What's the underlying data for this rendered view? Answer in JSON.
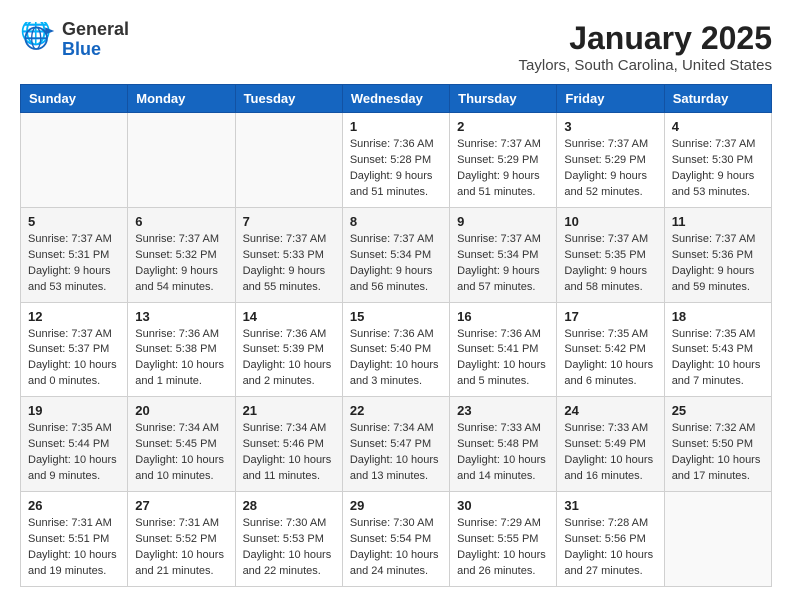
{
  "header": {
    "logo_general": "General",
    "logo_blue": "Blue",
    "month": "January 2025",
    "location": "Taylors, South Carolina, United States"
  },
  "weekdays": [
    "Sunday",
    "Monday",
    "Tuesday",
    "Wednesday",
    "Thursday",
    "Friday",
    "Saturday"
  ],
  "weeks": [
    [
      {
        "day": "",
        "info": ""
      },
      {
        "day": "",
        "info": ""
      },
      {
        "day": "",
        "info": ""
      },
      {
        "day": "1",
        "info": "Sunrise: 7:36 AM\nSunset: 5:28 PM\nDaylight: 9 hours\nand 51 minutes."
      },
      {
        "day": "2",
        "info": "Sunrise: 7:37 AM\nSunset: 5:29 PM\nDaylight: 9 hours\nand 51 minutes."
      },
      {
        "day": "3",
        "info": "Sunrise: 7:37 AM\nSunset: 5:29 PM\nDaylight: 9 hours\nand 52 minutes."
      },
      {
        "day": "4",
        "info": "Sunrise: 7:37 AM\nSunset: 5:30 PM\nDaylight: 9 hours\nand 53 minutes."
      }
    ],
    [
      {
        "day": "5",
        "info": "Sunrise: 7:37 AM\nSunset: 5:31 PM\nDaylight: 9 hours\nand 53 minutes."
      },
      {
        "day": "6",
        "info": "Sunrise: 7:37 AM\nSunset: 5:32 PM\nDaylight: 9 hours\nand 54 minutes."
      },
      {
        "day": "7",
        "info": "Sunrise: 7:37 AM\nSunset: 5:33 PM\nDaylight: 9 hours\nand 55 minutes."
      },
      {
        "day": "8",
        "info": "Sunrise: 7:37 AM\nSunset: 5:34 PM\nDaylight: 9 hours\nand 56 minutes."
      },
      {
        "day": "9",
        "info": "Sunrise: 7:37 AM\nSunset: 5:34 PM\nDaylight: 9 hours\nand 57 minutes."
      },
      {
        "day": "10",
        "info": "Sunrise: 7:37 AM\nSunset: 5:35 PM\nDaylight: 9 hours\nand 58 minutes."
      },
      {
        "day": "11",
        "info": "Sunrise: 7:37 AM\nSunset: 5:36 PM\nDaylight: 9 hours\nand 59 minutes."
      }
    ],
    [
      {
        "day": "12",
        "info": "Sunrise: 7:37 AM\nSunset: 5:37 PM\nDaylight: 10 hours\nand 0 minutes."
      },
      {
        "day": "13",
        "info": "Sunrise: 7:36 AM\nSunset: 5:38 PM\nDaylight: 10 hours\nand 1 minute."
      },
      {
        "day": "14",
        "info": "Sunrise: 7:36 AM\nSunset: 5:39 PM\nDaylight: 10 hours\nand 2 minutes."
      },
      {
        "day": "15",
        "info": "Sunrise: 7:36 AM\nSunset: 5:40 PM\nDaylight: 10 hours\nand 3 minutes."
      },
      {
        "day": "16",
        "info": "Sunrise: 7:36 AM\nSunset: 5:41 PM\nDaylight: 10 hours\nand 5 minutes."
      },
      {
        "day": "17",
        "info": "Sunrise: 7:35 AM\nSunset: 5:42 PM\nDaylight: 10 hours\nand 6 minutes."
      },
      {
        "day": "18",
        "info": "Sunrise: 7:35 AM\nSunset: 5:43 PM\nDaylight: 10 hours\nand 7 minutes."
      }
    ],
    [
      {
        "day": "19",
        "info": "Sunrise: 7:35 AM\nSunset: 5:44 PM\nDaylight: 10 hours\nand 9 minutes."
      },
      {
        "day": "20",
        "info": "Sunrise: 7:34 AM\nSunset: 5:45 PM\nDaylight: 10 hours\nand 10 minutes."
      },
      {
        "day": "21",
        "info": "Sunrise: 7:34 AM\nSunset: 5:46 PM\nDaylight: 10 hours\nand 11 minutes."
      },
      {
        "day": "22",
        "info": "Sunrise: 7:34 AM\nSunset: 5:47 PM\nDaylight: 10 hours\nand 13 minutes."
      },
      {
        "day": "23",
        "info": "Sunrise: 7:33 AM\nSunset: 5:48 PM\nDaylight: 10 hours\nand 14 minutes."
      },
      {
        "day": "24",
        "info": "Sunrise: 7:33 AM\nSunset: 5:49 PM\nDaylight: 10 hours\nand 16 minutes."
      },
      {
        "day": "25",
        "info": "Sunrise: 7:32 AM\nSunset: 5:50 PM\nDaylight: 10 hours\nand 17 minutes."
      }
    ],
    [
      {
        "day": "26",
        "info": "Sunrise: 7:31 AM\nSunset: 5:51 PM\nDaylight: 10 hours\nand 19 minutes."
      },
      {
        "day": "27",
        "info": "Sunrise: 7:31 AM\nSunset: 5:52 PM\nDaylight: 10 hours\nand 21 minutes."
      },
      {
        "day": "28",
        "info": "Sunrise: 7:30 AM\nSunset: 5:53 PM\nDaylight: 10 hours\nand 22 minutes."
      },
      {
        "day": "29",
        "info": "Sunrise: 7:30 AM\nSunset: 5:54 PM\nDaylight: 10 hours\nand 24 minutes."
      },
      {
        "day": "30",
        "info": "Sunrise: 7:29 AM\nSunset: 5:55 PM\nDaylight: 10 hours\nand 26 minutes."
      },
      {
        "day": "31",
        "info": "Sunrise: 7:28 AM\nSunset: 5:56 PM\nDaylight: 10 hours\nand 27 minutes."
      },
      {
        "day": "",
        "info": ""
      }
    ]
  ]
}
